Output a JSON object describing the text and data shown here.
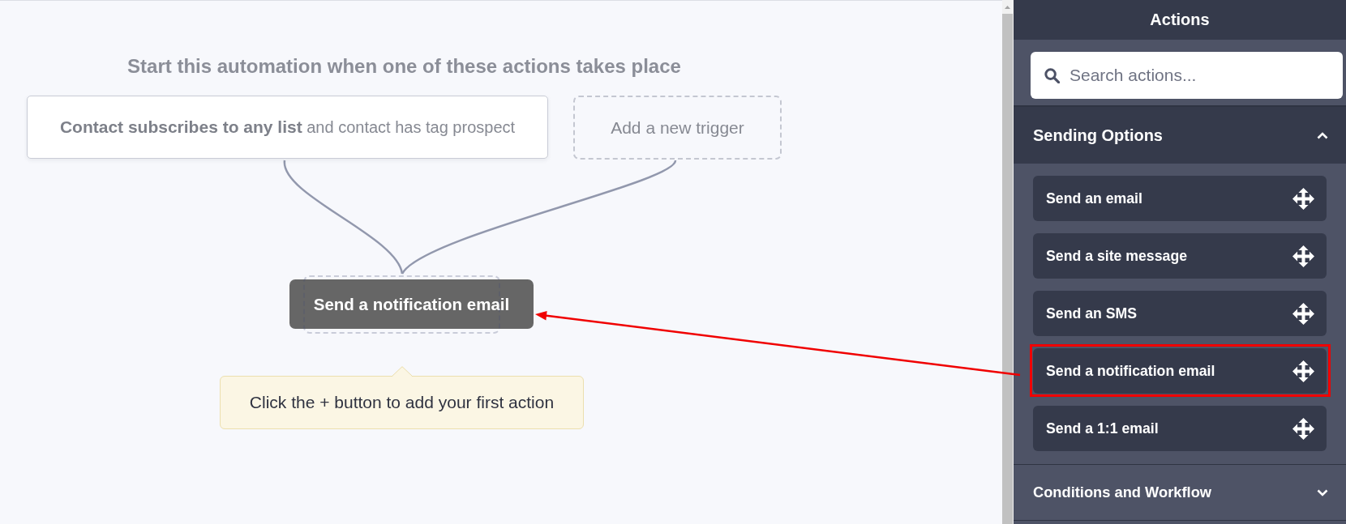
{
  "canvas": {
    "heading": "Start this automation when one of these actions takes place",
    "triggers": [
      {
        "kind": "trigger",
        "text": "**Contact subscribes to any list** and contact has tag prospect"
      },
      {
        "kind": "add",
        "text": "Add a new trigger"
      }
    ],
    "action_node": {
      "label": "Send a notification email"
    },
    "tooltip": {
      "text": "Click the + button to add your first action"
    }
  },
  "panel": {
    "title": "Actions",
    "search": {
      "placeholder": "Search actions..."
    },
    "sections": [
      {
        "title": "Sending Options",
        "expanded": true,
        "items": [
          {
            "label": "Send an email",
            "highlighted": false
          },
          {
            "label": "Send a site message",
            "highlighted": false
          },
          {
            "label": "Send an SMS",
            "highlighted": false
          },
          {
            "label": "Send a notification email",
            "highlighted": true
          },
          {
            "label": "Send a 1:1 email",
            "highlighted": false
          }
        ]
      },
      {
        "title": "Conditions and Workflow",
        "expanded": false
      }
    ]
  }
}
